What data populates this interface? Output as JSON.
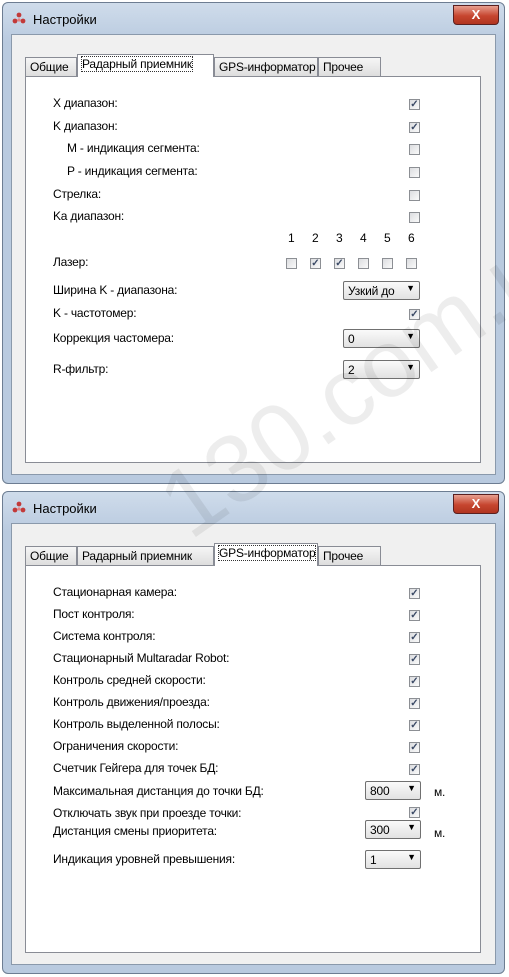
{
  "window_title": "Настройки",
  "close_label": "X",
  "tabs": [
    "Общие",
    "Радарный приемник",
    "GPS-информатор",
    "Прочее"
  ],
  "radar": {
    "rows": [
      {
        "label": "X диапазон:",
        "checked": true
      },
      {
        "label": "K диапазон:",
        "checked": true
      },
      {
        "label": "M - индикация сегмента:",
        "checked": false
      },
      {
        "label": "P - индикация сегмента:",
        "checked": false
      },
      {
        "label": "Стрелка:",
        "checked": false
      },
      {
        "label": "Ka диапазон:",
        "checked": false
      }
    ],
    "laser_label": "Лазер:",
    "laser_columns": [
      "1",
      "2",
      "3",
      "4",
      "5",
      "6"
    ],
    "laser_checked": [
      false,
      true,
      true,
      false,
      false,
      false
    ],
    "k_width_label": "Ширина K - диапазона:",
    "k_width_value": "Узкий до",
    "k_freq_label": "K - частотомер:",
    "k_freq_checked": true,
    "freq_corr_label": "Коррекция частомера:",
    "freq_corr_value": "0",
    "r_filter_label": "R-фильтр:",
    "r_filter_value": "2"
  },
  "gps": {
    "rows": [
      {
        "label": "Стационарная камера:",
        "checked": true
      },
      {
        "label": "Пост контроля:",
        "checked": true
      },
      {
        "label": "Система контроля:",
        "checked": true
      },
      {
        "label": "Стационарный Multaradar Robot:",
        "checked": true
      },
      {
        "label": "Контроль средней скорости:",
        "checked": true
      },
      {
        "label": "Контроль движения/проезда:",
        "checked": true
      },
      {
        "label": "Контроль выделенной полосы:",
        "checked": true
      },
      {
        "label": "Ограничения скорости:",
        "checked": true
      },
      {
        "label": "Счетчик Гейгера для точек БД:",
        "checked": true
      }
    ],
    "max_dist_label": "Максимальная дистанция до точки БД:",
    "max_dist_value": "800",
    "max_dist_unit": "м.",
    "mute_label": "Отключать звук при проезде точки:",
    "mute_checked": true,
    "priority_label": "Дистанция смены приоритета:",
    "priority_value": "300",
    "priority_unit": "м.",
    "levels_label": "Индикация уровней превышения:",
    "levels_value": "1"
  },
  "watermark": "130.com.ua"
}
